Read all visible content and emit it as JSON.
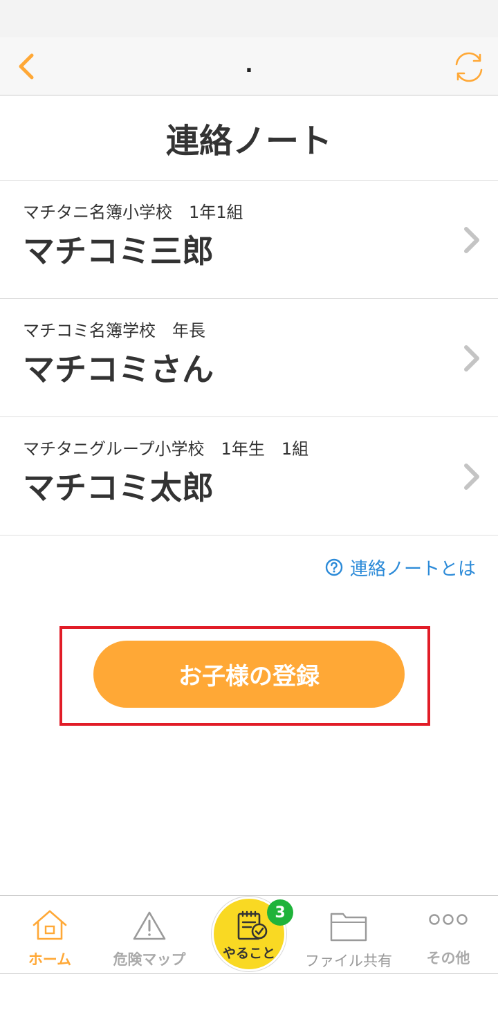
{
  "nav": {
    "title": "."
  },
  "page": {
    "title": "連絡ノート"
  },
  "children": [
    {
      "school": "マチタニ名簿小学校　1年1組",
      "name": "マチコミ三郎"
    },
    {
      "school": "マチコミ名簿学校　年長",
      "name": "マチコミさん"
    },
    {
      "school": "マチタニグループ小学校　1年生　1組",
      "name": "マチコミ太郎"
    }
  ],
  "help": {
    "label": "連絡ノートとは",
    "icon": "question-circle-icon"
  },
  "register": {
    "label": "お子様の登録"
  },
  "tabs": {
    "home": {
      "label": "ホーム",
      "icon": "home-icon"
    },
    "danger_map": {
      "label": "危険マップ",
      "icon": "warning-icon"
    },
    "todo": {
      "label": "やること",
      "icon": "todo-icon",
      "badge": "3"
    },
    "file_share": {
      "label": "ファイル共有",
      "icon": "folder-icon"
    },
    "other": {
      "label": "その他",
      "icon": "more-icon"
    }
  },
  "colors": {
    "accent": "#ffa836",
    "link": "#2b8ad8",
    "highlight": "#e11c27",
    "badge": "#1fb33a",
    "todo": "#f9d923"
  }
}
